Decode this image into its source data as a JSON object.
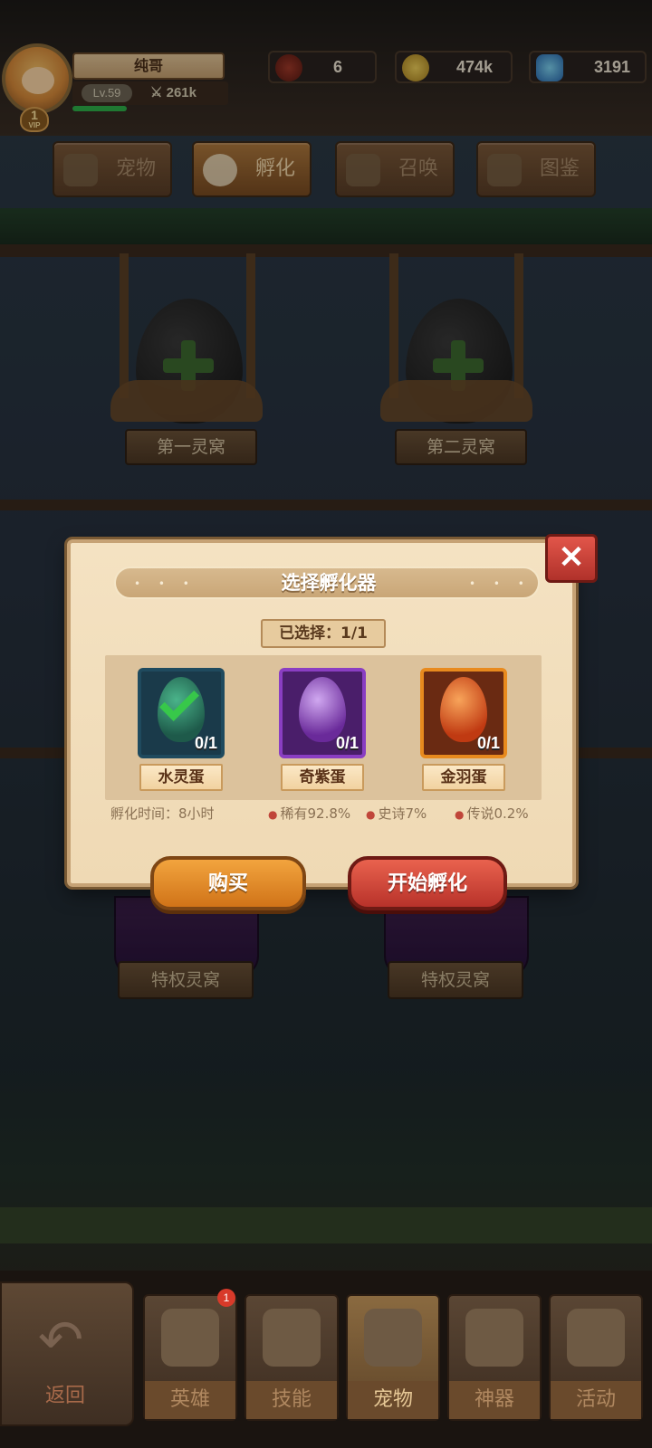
{
  "player": {
    "name": "纯哥",
    "level": "Lv.59",
    "power": "261k",
    "vip": "1",
    "vip_label": "VIP"
  },
  "resources": [
    {
      "icon": "spider-token-icon",
      "value": "6"
    },
    {
      "icon": "gold-coin-icon",
      "value": "474k"
    },
    {
      "icon": "diamond-icon",
      "value": "3191"
    }
  ],
  "tabs": [
    {
      "label": "宠物",
      "icon": "pet-icon"
    },
    {
      "label": "孵化",
      "icon": "egg-icon",
      "active": true
    },
    {
      "label": "召唤",
      "icon": "paw-icon"
    },
    {
      "label": "图鉴",
      "icon": "book-icon"
    }
  ],
  "nests": [
    {
      "label": "第一灵窝"
    },
    {
      "label": "第二灵窝"
    }
  ],
  "privilege_nests": [
    {
      "label": "特权灵窝"
    },
    {
      "label": "特权灵窝"
    }
  ],
  "dialog": {
    "title": "选择孵化器",
    "selected": "已选择：1/1",
    "eggs": [
      {
        "name": "水灵蛋",
        "count": "0/1",
        "selected": true,
        "frame_color": "#1f4a5e",
        "egg_color": "#2e8a6a"
      },
      {
        "name": "奇紫蛋",
        "count": "0/1",
        "selected": false,
        "frame_color": "#8a3ec2",
        "egg_color": "#9a5ad2"
      },
      {
        "name": "金羽蛋",
        "count": "0/1",
        "selected": false,
        "frame_color": "#e88a1e",
        "egg_color": "#e0561e"
      }
    ],
    "hatch_time": "孵化时间：8小时",
    "rarity_rare": "稀有92.8%",
    "rarity_epic": "史诗7%",
    "rarity_legend": "传说0.2%",
    "buy_label": "购买",
    "hatch_label": "开始孵化",
    "close_glyph": "✕"
  },
  "bottom_nav": {
    "back_label": "返回",
    "items": [
      {
        "label": "英雄",
        "icon": "helmet-icon",
        "badge": "1"
      },
      {
        "label": "技能",
        "icon": "spellbook-icon"
      },
      {
        "label": "宠物",
        "icon": "wings-icon",
        "active": true
      },
      {
        "label": "神器",
        "icon": "artifact-icon"
      },
      {
        "label": "活动",
        "icon": "horn-icon"
      }
    ]
  }
}
